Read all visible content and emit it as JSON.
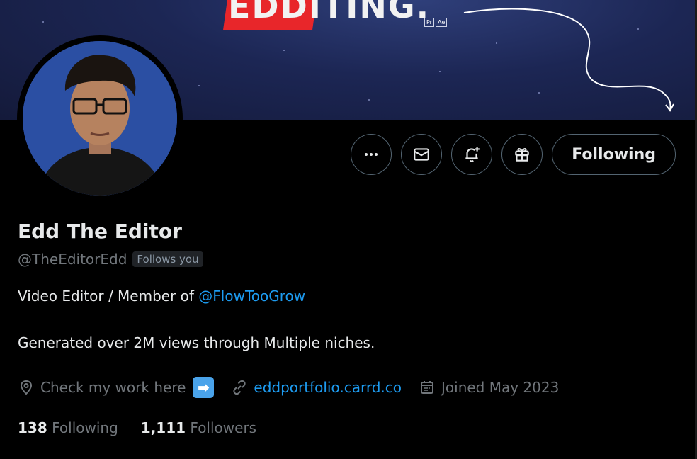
{
  "banner": {
    "word": "EDDITING.",
    "tags": [
      "Pr",
      "Ae"
    ]
  },
  "actions": {
    "more_icon": "more-horizontal-icon",
    "message_icon": "mail-icon",
    "notify_icon": "bell-plus-icon",
    "gift_icon": "gift-icon",
    "follow_label": "Following"
  },
  "profile": {
    "name": "Edd The Editor",
    "handle": "@TheEditorEdd",
    "follows_you": "Follows you",
    "bio_line1_prefix": "Video Editor / Member of ",
    "bio_line1_mention": "@FlowTooGrow",
    "bio_line2": "Generated over 2M views through Multiple niches.",
    "location": "Check my work here",
    "location_emoji": "➡",
    "website": "eddportfolio.carrd.co",
    "joined": "Joined May 2023"
  },
  "stats": {
    "following_count": "138",
    "following_label": "Following",
    "followers_count": "1,111",
    "followers_label": "Followers"
  },
  "colors": {
    "accent": "#1d9bf0",
    "muted": "#71767b",
    "text": "#e7e9ea",
    "banner_red": "#e8262a"
  }
}
